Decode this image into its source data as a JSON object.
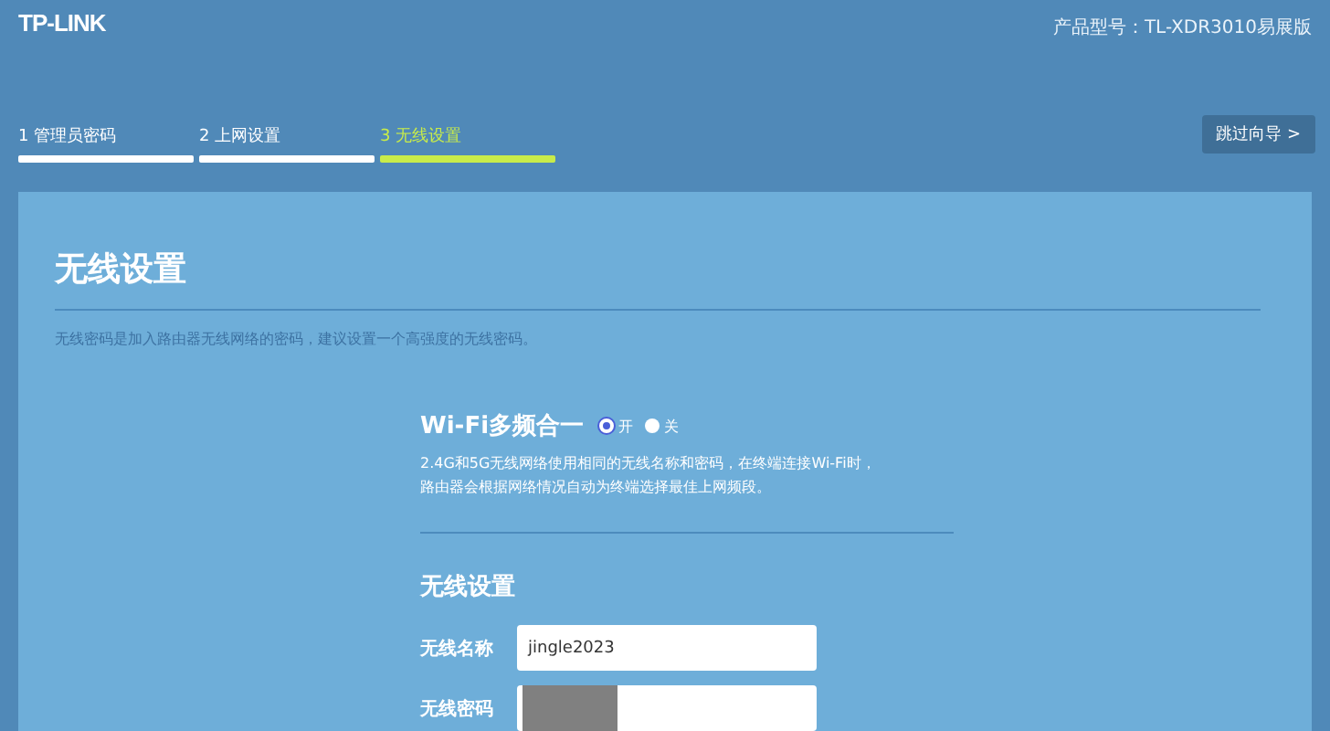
{
  "header": {
    "logo": "TP-LINK",
    "product_model": "产品型号：TL-XDR3010易展版"
  },
  "steps": [
    {
      "label": "1 管理员密码",
      "selected": false
    },
    {
      "label": "2 上网设置",
      "selected": false
    },
    {
      "label": "3 无线设置",
      "selected": true
    }
  ],
  "skip_button": "跳过向导 >",
  "panel": {
    "title": "无线设置",
    "description": "无线密码是加入路由器无线网络的密码，建议设置一个高强度的无线密码。",
    "multiband": {
      "label": "Wi-Fi多频合一",
      "options": [
        {
          "label": "开",
          "selected": true
        },
        {
          "label": "关",
          "selected": false
        }
      ],
      "note_lines": [
        "2.4G和5G无线网络使用相同的无线名称和密码，在终端连接Wi-Fi时，",
        "路由器会根据网络情况自动为终端选择最佳上网频段。"
      ]
    },
    "section_title": "无线设置",
    "fields": [
      {
        "label": "无线名称",
        "value": "jingle2023",
        "kind": "text"
      },
      {
        "label": "无线密码",
        "kind": "masked"
      }
    ]
  }
}
